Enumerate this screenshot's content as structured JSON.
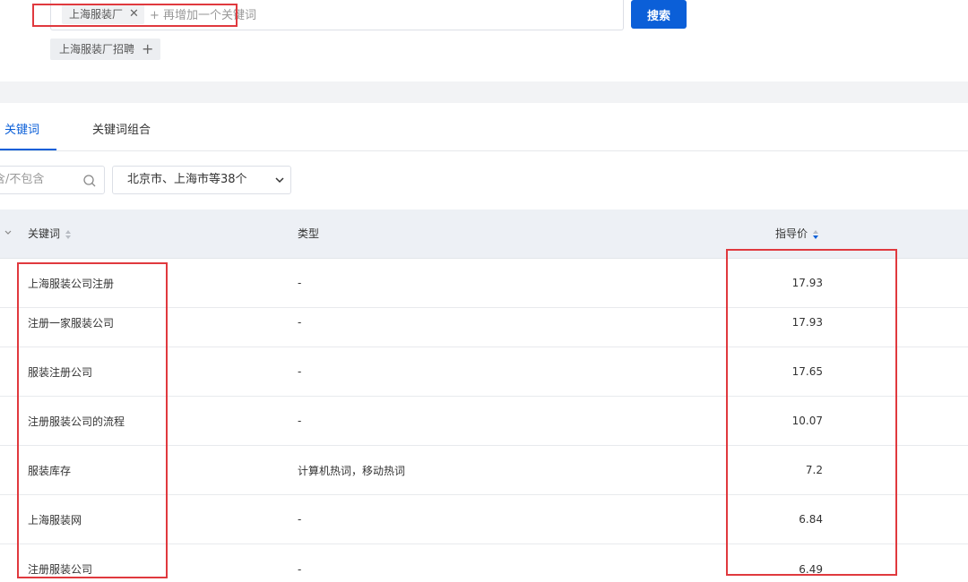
{
  "search": {
    "tag_label": "上海服装厂",
    "add_placeholder": "+ 再增加一个关键词",
    "button_label": "搜索",
    "suggestion": "上海服装厂招聘"
  },
  "tabs": [
    {
      "label": "关键词",
      "active": true
    },
    {
      "label": "关键词组合",
      "active": false
    }
  ],
  "filters": {
    "include_placeholder": "含/不包含",
    "region": "北京市、上海市等38个"
  },
  "table": {
    "headers": {
      "keyword": "关键词",
      "type": "类型",
      "price": "指导价"
    },
    "rows": [
      {
        "keyword": "上海服装公司注册",
        "type": "-",
        "price": "17.93"
      },
      {
        "keyword": "注册一家服装公司",
        "type": "-",
        "price": "17.93"
      },
      {
        "keyword": "服装注册公司",
        "type": "-",
        "price": "17.65"
      },
      {
        "keyword": "注册服装公司的流程",
        "type": "-",
        "price": "10.07"
      },
      {
        "keyword": "服装库存",
        "type": "计算机热词，移动热词",
        "price": "7.2"
      },
      {
        "keyword": "上海服装网",
        "type": "-",
        "price": "6.84"
      },
      {
        "keyword": "注册服装公司",
        "type": "-",
        "price": "6.49"
      }
    ]
  },
  "colors": {
    "accent": "#0b5fd8",
    "annotation": "#e0393e"
  }
}
